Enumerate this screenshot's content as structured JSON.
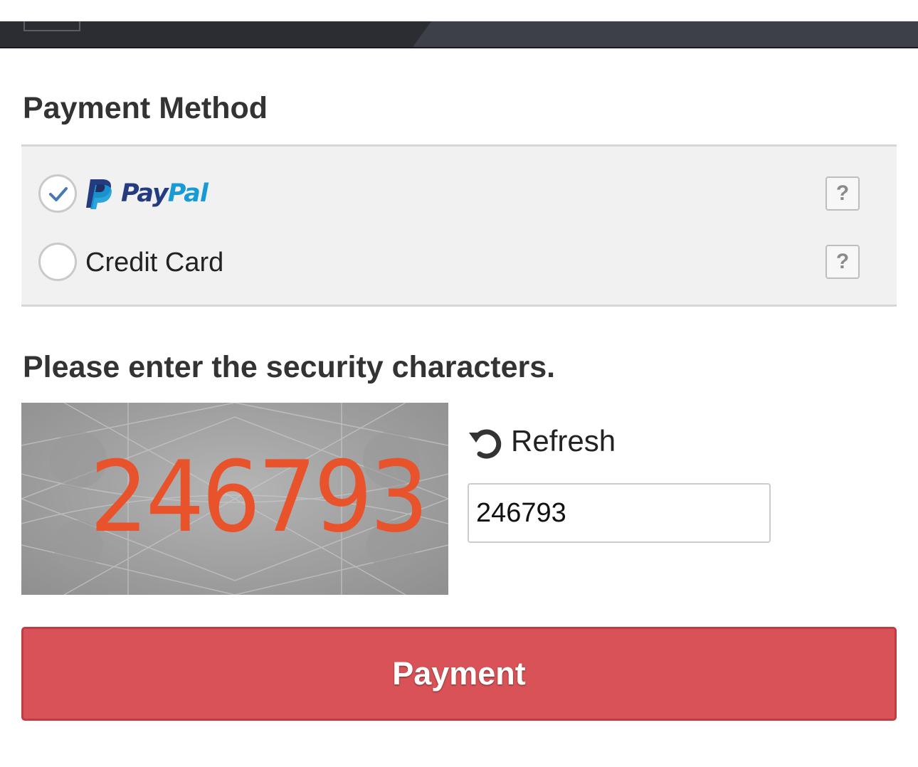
{
  "colors": {
    "topbar_dark": "#2b2d33",
    "topbar_mid": "#3d4049",
    "paypal_dark_blue": "#253b80",
    "paypal_light_blue": "#179bd7",
    "captcha_digits": "#e8532b",
    "payment_button": "#d95257",
    "check_mark": "#4a78b5"
  },
  "payment_method": {
    "title": "Payment Method",
    "options": [
      {
        "id": "paypal",
        "label_part1": "Pay",
        "label_part2": "Pal",
        "selected": true,
        "help_label": "?",
        "icon": "paypal-logo"
      },
      {
        "id": "credit_card",
        "label": "Credit Card",
        "selected": false,
        "help_label": "?"
      }
    ]
  },
  "security": {
    "title": "Please enter the security characters.",
    "captcha_text": "246793",
    "refresh_label": "Refresh",
    "refresh_icon": "refresh-icon",
    "input_value": "246793"
  },
  "payment_button": {
    "label": "Payment"
  }
}
